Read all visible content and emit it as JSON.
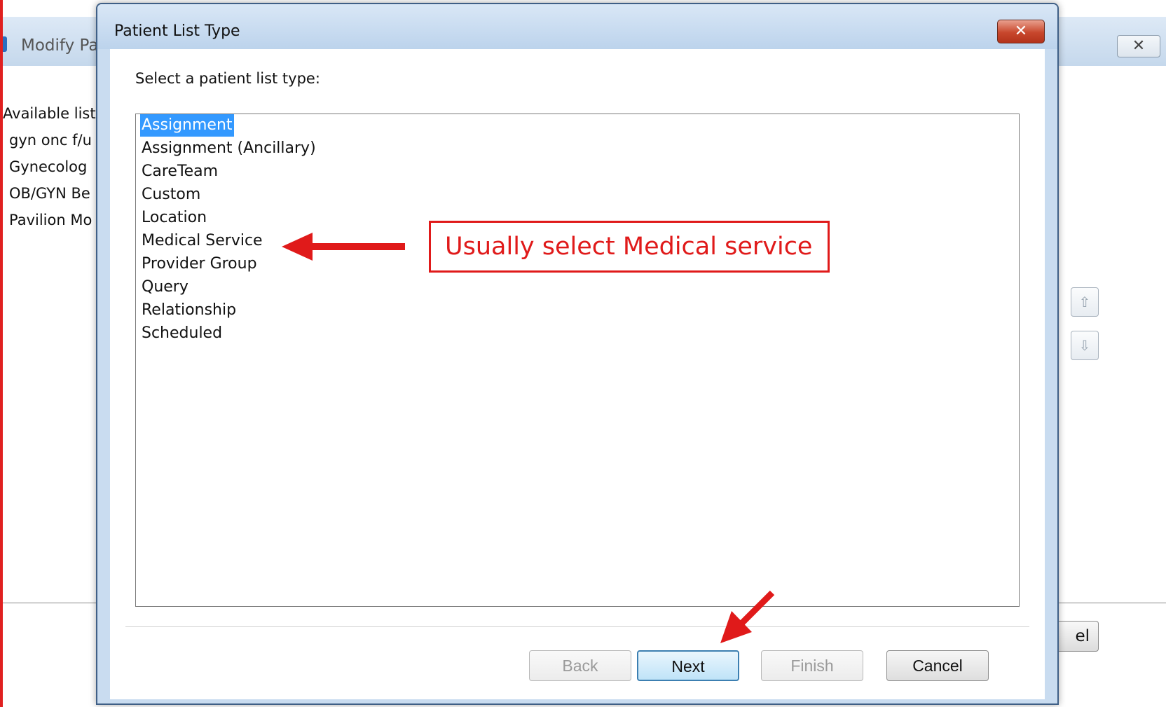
{
  "background_window": {
    "title": "Modify Pa",
    "close_glyph": "✕",
    "available_label": "Available list",
    "list_items": [
      "gyn onc f/u",
      "Gynecolog",
      "OB/GYN Be",
      "Pavilion Mo"
    ],
    "up_icon": "up-arrow-icon",
    "down_icon": "down-arrow-icon",
    "cancel_partial": "el"
  },
  "dialog": {
    "title": "Patient List Type",
    "close_glyph": "✕",
    "prompt": "Select a patient list type:",
    "list_types": [
      {
        "label": "Assignment",
        "selected": true
      },
      {
        "label": "Assignment (Ancillary)",
        "selected": false
      },
      {
        "label": "CareTeam",
        "selected": false
      },
      {
        "label": "Custom",
        "selected": false
      },
      {
        "label": "Location",
        "selected": false
      },
      {
        "label": "Medical Service",
        "selected": false
      },
      {
        "label": "Provider Group",
        "selected": false
      },
      {
        "label": "Query",
        "selected": false
      },
      {
        "label": "Relationship",
        "selected": false
      },
      {
        "label": "Scheduled",
        "selected": false
      }
    ],
    "buttons": {
      "back": "Back",
      "next": "Next",
      "finish": "Finish",
      "cancel": "Cancel"
    }
  },
  "annotation": {
    "callout_text": "Usually select Medical service",
    "color": "#e01a1a"
  },
  "colors": {
    "selection": "#3399ff",
    "titlebar": "#c9dcf0",
    "close_button": "#c8472c"
  }
}
